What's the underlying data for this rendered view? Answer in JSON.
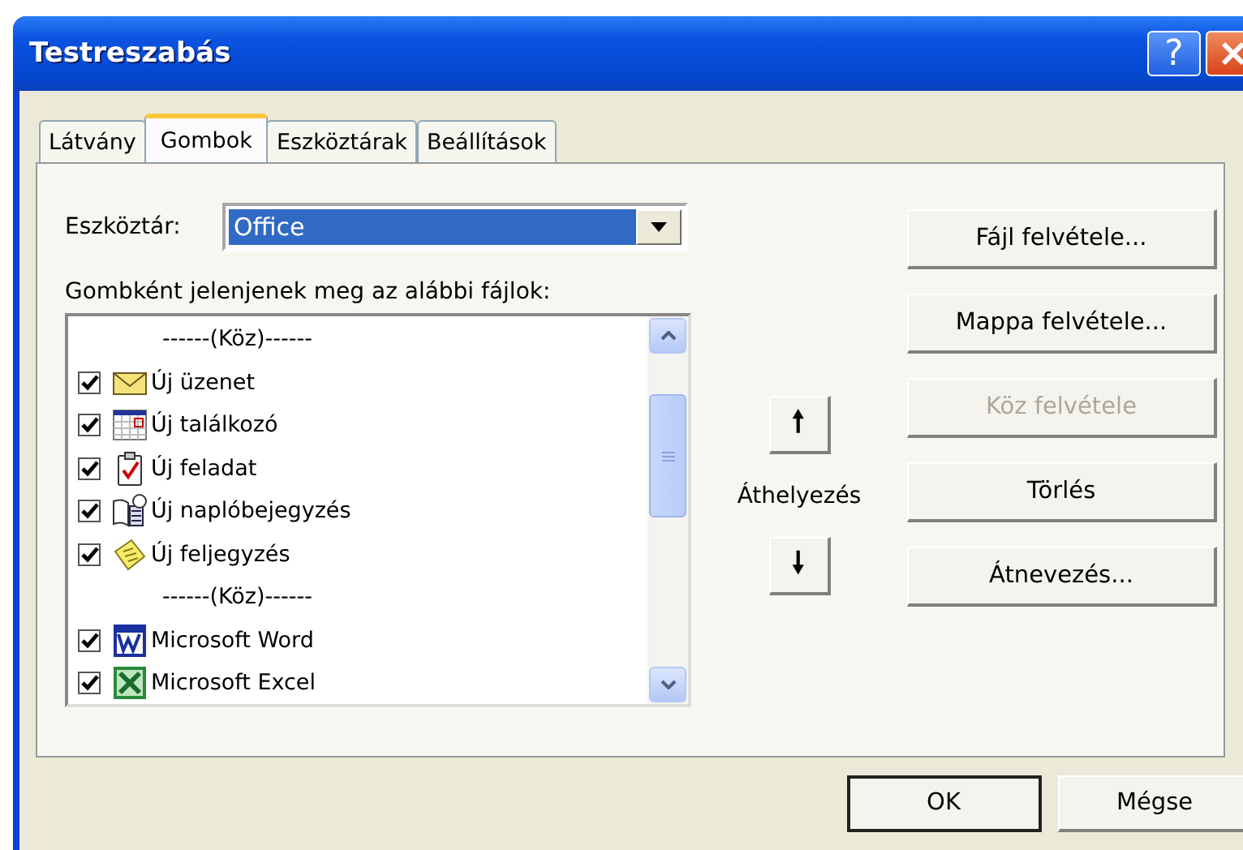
{
  "window": {
    "title": "Testreszabás",
    "help": "?"
  },
  "tabs": [
    {
      "label": "Látvány",
      "selected": false
    },
    {
      "label": "Gombok",
      "selected": true
    },
    {
      "label": "Eszköztárak",
      "selected": false
    },
    {
      "label": "Beállítások",
      "selected": false
    }
  ],
  "toolbar_select": {
    "label": "Eszköztár:",
    "value": "Office"
  },
  "list_label": "Gombként jelenjenek meg az alábbi fájlok:",
  "items": [
    {
      "kind": "separator",
      "label": "------(Köz)------"
    },
    {
      "kind": "item",
      "label": "Új üzenet",
      "checked": true
    },
    {
      "kind": "item",
      "label": "Új találkozó",
      "checked": true
    },
    {
      "kind": "item",
      "label": "Új feladat",
      "checked": true
    },
    {
      "kind": "item",
      "label": "Új naplóbejegyzés",
      "checked": true
    },
    {
      "kind": "item",
      "label": "Új feljegyzés",
      "checked": true
    },
    {
      "kind": "separator",
      "label": "------(Köz)------"
    },
    {
      "kind": "item",
      "label": "Microsoft Word",
      "checked": true
    },
    {
      "kind": "item",
      "label": "Microsoft Excel",
      "checked": true
    }
  ],
  "move": {
    "label": "Áthelyezés",
    "up": "🠕",
    "down": "🠗"
  },
  "actions": [
    {
      "label": "Fájl felvétele...",
      "disabled": false
    },
    {
      "label": "Mappa felvétele...",
      "disabled": false
    },
    {
      "label": "Köz felvétele",
      "disabled": true
    },
    {
      "label": "Törlés",
      "disabled": false
    },
    {
      "label": "Átnevezés...",
      "disabled": false
    }
  ],
  "buttons": [
    {
      "label": "OK",
      "default": true
    },
    {
      "label": "Mégse",
      "default": false
    }
  ]
}
